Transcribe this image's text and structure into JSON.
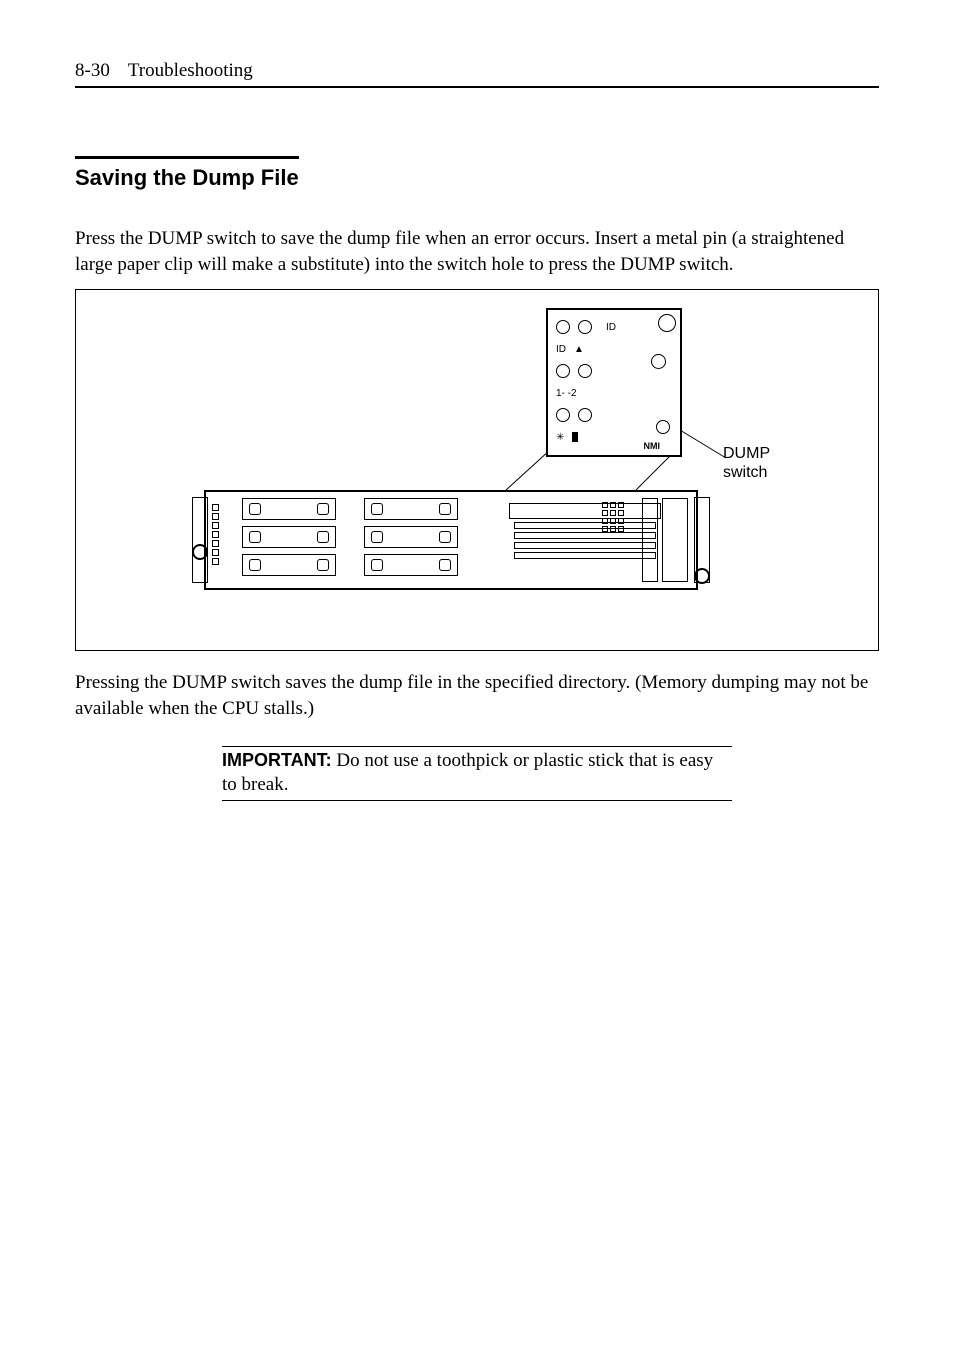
{
  "header": {
    "pageNumber": "8-30",
    "sectionName": "Troubleshooting"
  },
  "section": {
    "title": "Saving the Dump File",
    "para1": "Press the DUMP switch to save the dump file when an error occurs.    Insert a metal pin (a straightened large paper clip will make a substitute) into the switch hole to press the DUMP switch.",
    "para2": "Pressing the DUMP switch saves the dump file in the specified directory.    (Memory dumping may not be available when the CPU stalls.)"
  },
  "figure": {
    "calloutLabel": "DUMP\nswitch",
    "panel": {
      "idLabel": "ID",
      "idLabel2": "ID",
      "lanLabel": "1-    -2",
      "nmiLabel": "NMI"
    }
  },
  "note": {
    "important": "IMPORTANT:",
    "text": " Do not use a toothpick or plastic stick that is easy to break."
  }
}
